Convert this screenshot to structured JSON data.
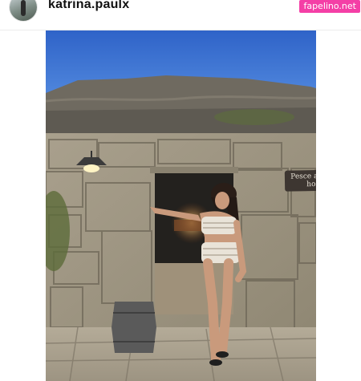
{
  "post": {
    "username": "katrina.paulx",
    "watermark": "fapelino.net",
    "sign_text": "Pesce and grill hostel"
  },
  "icons": {
    "avatar": "profile-avatar"
  }
}
